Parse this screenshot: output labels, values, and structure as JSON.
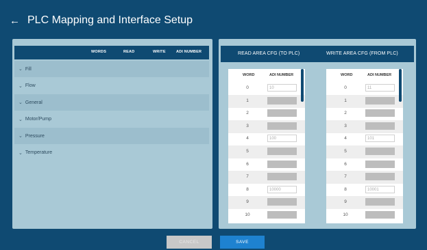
{
  "header": {
    "title": "PLC Mapping and Interface Setup",
    "back_icon": "←"
  },
  "left": {
    "columns": [
      "WORDS",
      "READ",
      "WRITE",
      "ADI NUMBER"
    ],
    "categories": [
      "Fill",
      "Flow",
      "General",
      "Motor/Pump",
      "Pressure",
      "Temperature"
    ],
    "chevron": "⌄"
  },
  "right": {
    "read_title": "READ AREA CFG (TO PLC)",
    "write_title": "WRITE AREA CFG (FROM PLC)",
    "read": {
      "headers": [
        "WORD",
        "ADI NUMBER"
      ],
      "rows": [
        {
          "word": "0",
          "adi": "10"
        },
        {
          "word": "1",
          "adi": ""
        },
        {
          "word": "2",
          "adi": ""
        },
        {
          "word": "3",
          "adi": ""
        },
        {
          "word": "4",
          "adi": "100"
        },
        {
          "word": "5",
          "adi": ""
        },
        {
          "word": "6",
          "adi": ""
        },
        {
          "word": "7",
          "adi": ""
        },
        {
          "word": "8",
          "adi": "10000"
        },
        {
          "word": "9",
          "adi": ""
        },
        {
          "word": "10",
          "adi": ""
        }
      ]
    },
    "write": {
      "headers": [
        "WORD",
        "ADI NUMBER"
      ],
      "rows": [
        {
          "word": "0",
          "adi": "11"
        },
        {
          "word": "1",
          "adi": ""
        },
        {
          "word": "2",
          "adi": ""
        },
        {
          "word": "3",
          "adi": ""
        },
        {
          "word": "4",
          "adi": "101"
        },
        {
          "word": "5",
          "adi": ""
        },
        {
          "word": "6",
          "adi": ""
        },
        {
          "word": "7",
          "adi": ""
        },
        {
          "word": "8",
          "adi": "10001"
        },
        {
          "word": "9",
          "adi": ""
        },
        {
          "word": "10",
          "adi": ""
        }
      ]
    }
  },
  "buttons": {
    "cancel": "CANCEL",
    "save": "SAVE"
  }
}
